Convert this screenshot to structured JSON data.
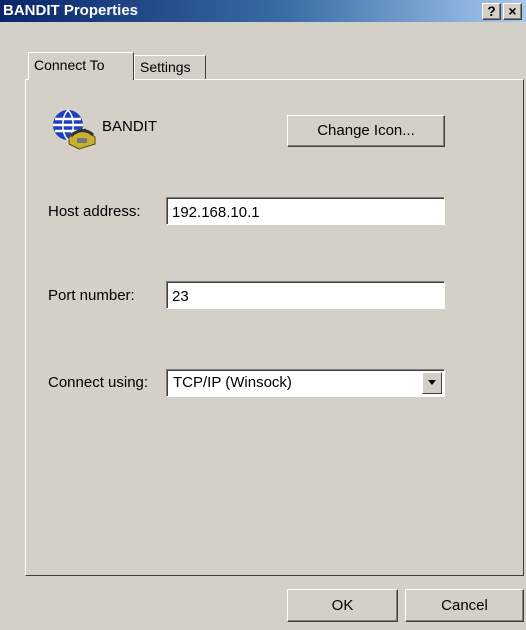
{
  "window": {
    "title": "BANDIT Properties",
    "help_label": "?",
    "close_label": "×"
  },
  "tabs": [
    {
      "label": "Connect To",
      "active": true
    },
    {
      "label": "Settings",
      "active": false
    }
  ],
  "connection": {
    "name": "BANDIT",
    "icon": "phone-globe-icon",
    "change_icon_label": "Change Icon..."
  },
  "form": {
    "host_label": "Host address:",
    "host_value": "192.168.10.1",
    "port_label": "Port number:",
    "port_value": "23",
    "connect_label": "Connect using:",
    "connect_value": "TCP/IP (Winsock)"
  },
  "buttons": {
    "ok_label": "OK",
    "cancel_label": "Cancel"
  },
  "colors": {
    "titlebar_start": "#0a246a",
    "titlebar_end": "#a6caf0",
    "face": "#d4d0c8"
  }
}
